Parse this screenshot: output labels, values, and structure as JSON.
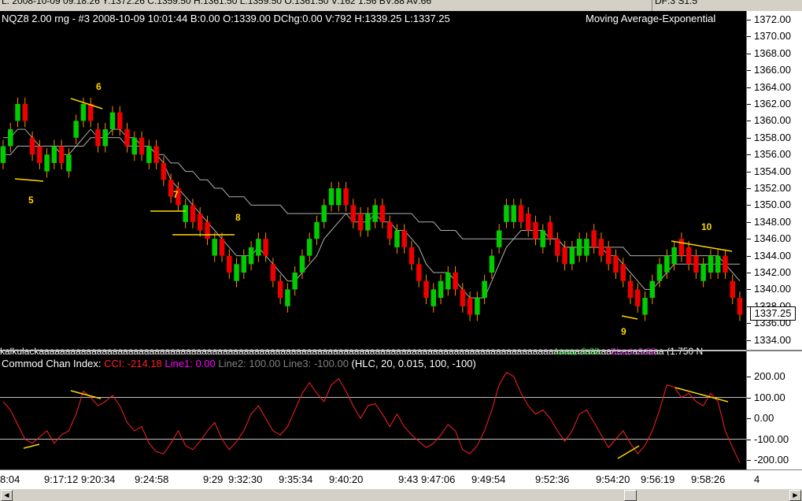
{
  "top_strip": {
    "quote_text": "L: 2008-10-09  09:18:26  Y:1372.26  C:1359.50  H:1361.50  L:1359.50  O:1361.50  V:162  1:56  BV:88  AV:66",
    "right_text": "DF:3  S1:5"
  },
  "price_pane": {
    "header": "NQZ8   2.00 rng - #3   2008-10-09   10:01:44   B:0.00   O:1339.00   DChg:0.00   V:792   H:1339.25   L:1337.25",
    "indicator_name": "Moving Average-Exponential",
    "last_price": "1337.25",
    "price_ticks": [
      "1372.00",
      "1370.00",
      "1368.00",
      "1366.00",
      "1364.00",
      "1362.00",
      "1360.00",
      "1358.00",
      "1356.00",
      "1354.00",
      "1352.00",
      "1350.00",
      "1348.00",
      "1346.00",
      "1344.00",
      "1342.00",
      "1340.00",
      "1338.00",
      "1336.00",
      "1334.00"
    ],
    "wave_labels": [
      "5",
      "6",
      "7",
      "8",
      "9",
      "10"
    ],
    "colors": {
      "up_bar": "#00cc00",
      "down_bar": "#ee0000",
      "wick": "#ff8c00",
      "wave_line": "#ffd700",
      "ema": "#b0b0b0"
    }
  },
  "strip": {
    "kalkulack": "kalkulacka",
    "kalk_tail": "aaaaaaaaaaaaaaaaaaaaaaaaaaaaaaaaaaaaaaaaaaaaaaaaaaaaaaaaaaaaaaaaaaaaaaaaaaaaaaaaaaaaaaaaaaaaaaaaaaaaaaaaaaaaaaaaaaaaaa",
    "long": "Long: 0.00",
    "short": "Short: 0.00",
    "tail": "(1.750  N"
  },
  "cci_pane": {
    "name": "Commod Chan Index:",
    "cci": "CCI: -214.18",
    "line1": "Line1: 0.00",
    "line2": "Line2: 100.00",
    "line3": "Line3: -100.00",
    "params": "(HLC, 20, 0.015, 100, -100)",
    "ticks": [
      "200.00",
      "100.00",
      "0.00",
      "-100.00",
      "-200.00"
    ],
    "colors": {
      "cci": "#ff2020",
      "ref_line": "#c0c0c0",
      "divergence": "#ffd700"
    }
  },
  "time_axis": {
    "labels": [
      "8:04",
      "9:17:12",
      "9:20:34",
      "9:24:58",
      "9:29",
      "9:32:30",
      "9:35:34",
      "9:40:20",
      "9:43",
      "9:47:06",
      "9:49:54",
      "9:52:36",
      "9:54:20",
      "9:56:19",
      "9:58:26",
      "4"
    ]
  },
  "chart_data": {
    "type": "line",
    "price": [
      1357,
      1359,
      1362,
      1360,
      1356,
      1355,
      1356,
      1357,
      1355,
      1356,
      1360,
      1362,
      1360,
      1357,
      1359,
      1361,
      1359,
      1357,
      1358,
      1356,
      1357,
      1355,
      1353,
      1351,
      1350,
      1350,
      1348,
      1347,
      1346,
      1346,
      1344,
      1342,
      1343,
      1344,
      1345,
      1346,
      1344,
      1341,
      1339,
      1340,
      1342,
      1344,
      1346,
      1348,
      1350,
      1352,
      1352,
      1350,
      1348,
      1347,
      1349,
      1350,
      1348,
      1346,
      1347,
      1345,
      1343,
      1341,
      1339,
      1340,
      1341,
      1342,
      1340,
      1338,
      1337,
      1339,
      1341,
      1344,
      1347,
      1350,
      1350,
      1348,
      1347,
      1346,
      1347,
      1346,
      1344,
      1343,
      1345,
      1346,
      1346,
      1345,
      1344,
      1343,
      1342,
      1341,
      1339,
      1338,
      1339,
      1341,
      1343,
      1344,
      1345,
      1344,
      1343,
      1342,
      1343,
      1344,
      1344,
      1342,
      1339,
      1337
    ],
    "ema_fast": [
      1358,
      1358,
      1359,
      1359,
      1358,
      1357,
      1357,
      1357,
      1356,
      1356,
      1357,
      1358,
      1359,
      1358,
      1358,
      1359,
      1359,
      1358,
      1358,
      1357,
      1357,
      1356,
      1355,
      1353,
      1352,
      1351,
      1350,
      1349,
      1348,
      1347,
      1346,
      1345,
      1344,
      1344,
      1344,
      1345,
      1344,
      1343,
      1342,
      1341,
      1341,
      1342,
      1343,
      1344,
      1346,
      1347,
      1348,
      1349,
      1348,
      1348,
      1348,
      1349,
      1348,
      1348,
      1347,
      1347,
      1346,
      1345,
      1343,
      1342,
      1342,
      1342,
      1341,
      1340,
      1339,
      1339,
      1339,
      1341,
      1343,
      1345,
      1346,
      1347,
      1347,
      1347,
      1347,
      1346,
      1346,
      1345,
      1345,
      1345,
      1345,
      1345,
      1345,
      1344,
      1344,
      1343,
      1342,
      1341,
      1340,
      1340,
      1341,
      1342,
      1343,
      1343,
      1343,
      1343,
      1343,
      1343,
      1343,
      1343,
      1342,
      1341
    ],
    "ema_slow": [
      1356,
      1356,
      1357,
      1357,
      1357,
      1357,
      1357,
      1357,
      1357,
      1357,
      1357,
      1357,
      1358,
      1358,
      1358,
      1358,
      1358,
      1357,
      1357,
      1357,
      1357,
      1356,
      1356,
      1355,
      1355,
      1354,
      1354,
      1353,
      1353,
      1352,
      1352,
      1351,
      1351,
      1351,
      1350,
      1350,
      1350,
      1350,
      1350,
      1349,
      1349,
      1349,
      1349,
      1349,
      1349,
      1349,
      1349,
      1349,
      1349,
      1349,
      1349,
      1349,
      1349,
      1349,
      1349,
      1349,
      1349,
      1348,
      1348,
      1348,
      1347,
      1347,
      1347,
      1346,
      1346,
      1346,
      1346,
      1346,
      1346,
      1346,
      1346,
      1346,
      1346,
      1346,
      1346,
      1346,
      1346,
      1345,
      1345,
      1345,
      1345,
      1345,
      1345,
      1345,
      1345,
      1345,
      1344,
      1344,
      1344,
      1344,
      1344,
      1344,
      1344,
      1344,
      1344,
      1344,
      1344,
      1344,
      1344,
      1343,
      1343,
      1343
    ],
    "cci": [
      80,
      40,
      -30,
      -100,
      -120,
      -90,
      -60,
      -120,
      -80,
      -60,
      20,
      130,
      100,
      60,
      80,
      110,
      60,
      -20,
      -60,
      -40,
      -120,
      -160,
      -170,
      -120,
      -60,
      -130,
      -150,
      -110,
      -60,
      -20,
      -100,
      -150,
      -110,
      -60,
      20,
      60,
      0,
      -60,
      -80,
      -40,
      40,
      120,
      170,
      120,
      80,
      160,
      190,
      130,
      60,
      0,
      60,
      70,
      20,
      -40,
      20,
      -40,
      -80,
      -110,
      -140,
      -120,
      -80,
      -30,
      -60,
      -150,
      -170,
      -130,
      -60,
      40,
      160,
      220,
      200,
      120,
      60,
      20,
      40,
      0,
      -60,
      -110,
      -60,
      20,
      40,
      -20,
      -80,
      -140,
      -100,
      -60,
      -120,
      -170,
      -130,
      -60,
      40,
      160,
      150,
      100,
      120,
      80,
      60,
      120,
      80,
      -60,
      -140,
      -214
    ],
    "ylim": [
      1333.5,
      1373
    ],
    "cci_ylim": [
      -250,
      250
    ]
  }
}
